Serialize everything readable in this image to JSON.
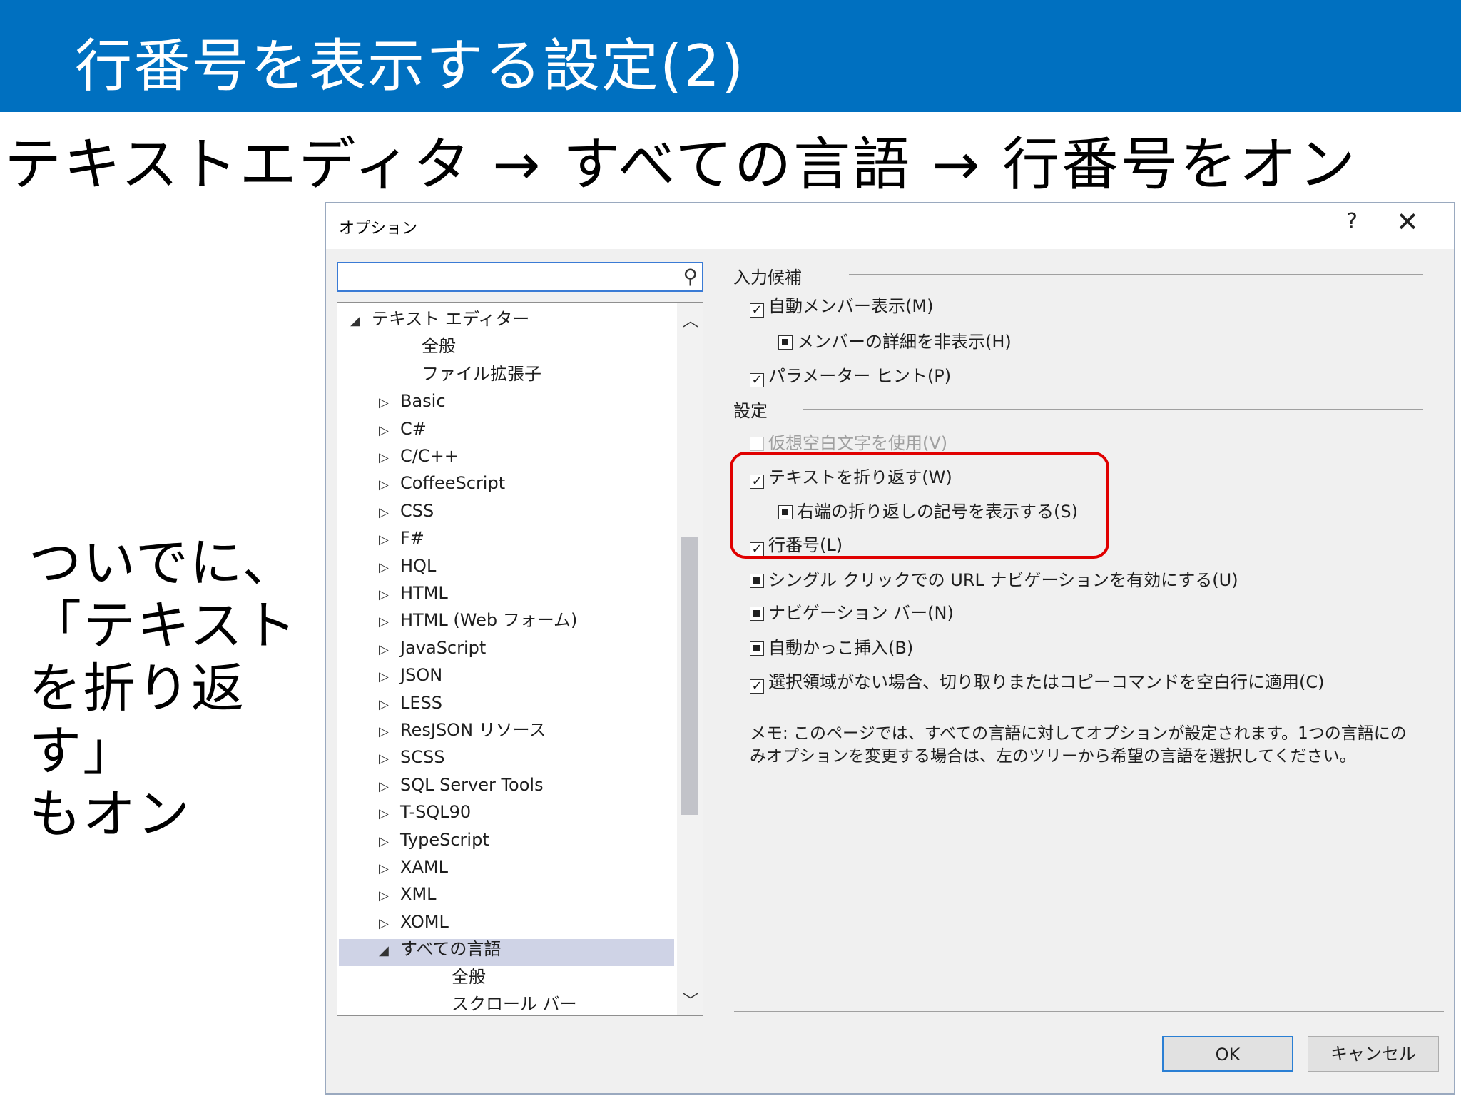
{
  "slide": {
    "title": "行番号を表示する設定(2)",
    "subtitle": "テキストエディタ → すべての言語 → 行番号をオン",
    "side_note_lines": [
      "ついでに、",
      "「テキスト",
      "を折り返",
      "す」",
      "もオン"
    ],
    "colors": {
      "title_bar": "#0070c0",
      "highlight": "#e00000"
    }
  },
  "dialog": {
    "title": "オプション",
    "help_label": "?",
    "close_label": "✕",
    "search": {
      "value": "",
      "placeholder": ""
    },
    "tree": {
      "items": [
        {
          "label": "テキスト エディター",
          "arrow": "◢"
        },
        {
          "label": "全般",
          "arrow": ""
        },
        {
          "label": "ファイル拡張子",
          "arrow": ""
        },
        {
          "label": "Basic",
          "arrow": "▷"
        },
        {
          "label": "C#",
          "arrow": "▷"
        },
        {
          "label": "C/C++",
          "arrow": "▷"
        },
        {
          "label": "CoffeeScript",
          "arrow": "▷"
        },
        {
          "label": "CSS",
          "arrow": "▷"
        },
        {
          "label": "F#",
          "arrow": "▷"
        },
        {
          "label": "HQL",
          "arrow": "▷"
        },
        {
          "label": "HTML",
          "arrow": "▷"
        },
        {
          "label": "HTML (Web フォーム)",
          "arrow": "▷"
        },
        {
          "label": "JavaScript",
          "arrow": "▷"
        },
        {
          "label": "JSON",
          "arrow": "▷"
        },
        {
          "label": "LESS",
          "arrow": "▷"
        },
        {
          "label": "ResJSON リソース",
          "arrow": "▷"
        },
        {
          "label": "SCSS",
          "arrow": "▷"
        },
        {
          "label": "SQL Server Tools",
          "arrow": "▷"
        },
        {
          "label": "T-SQL90",
          "arrow": "▷"
        },
        {
          "label": "TypeScript",
          "arrow": "▷"
        },
        {
          "label": "XAML",
          "arrow": "▷"
        },
        {
          "label": "XML",
          "arrow": "▷"
        },
        {
          "label": "XOML",
          "arrow": "▷"
        },
        {
          "label": "すべての言語",
          "arrow": "◢"
        },
        {
          "label": "全般",
          "arrow": ""
        },
        {
          "label": "スクロール バー",
          "arrow": ""
        }
      ],
      "selected": "すべての言語"
    },
    "sections": {
      "input": "入力候補",
      "settings": "設定"
    },
    "options": [
      {
        "label": "自動メンバー表示(M)",
        "state": "checked"
      },
      {
        "label": "メンバーの詳細を非表示(H)",
        "state": "partial"
      },
      {
        "label": "パラメーター ヒント(P)",
        "state": "checked"
      },
      {
        "label": "仮想空白文字を使用(V)",
        "state": "disabled"
      },
      {
        "label": "テキストを折り返す(W)",
        "state": "checked"
      },
      {
        "label": "右端の折り返しの記号を表示する(S)",
        "state": "partial"
      },
      {
        "label": "行番号(L)",
        "state": "checked"
      },
      {
        "label": "シングル クリックでの URL ナビゲーションを有効にする(U)",
        "state": "partial"
      },
      {
        "label": "ナビゲーション バー(N)",
        "state": "partial"
      },
      {
        "label": "自動かっこ挿入(B)",
        "state": "partial"
      },
      {
        "label": "選択領域がない場合、切り取りまたはコピーコマンドを空白行に適用(C)",
        "state": "checked"
      }
    ],
    "note": "メモ: このページでは、すべての言語に対してオプションが設定されます。1つの言語にのみオプションを変更する場合は、左のツリーから希望の言語を選択してください。",
    "buttons": {
      "ok": "OK",
      "cancel": "キャンセル"
    },
    "check_glyph": "✓"
  }
}
